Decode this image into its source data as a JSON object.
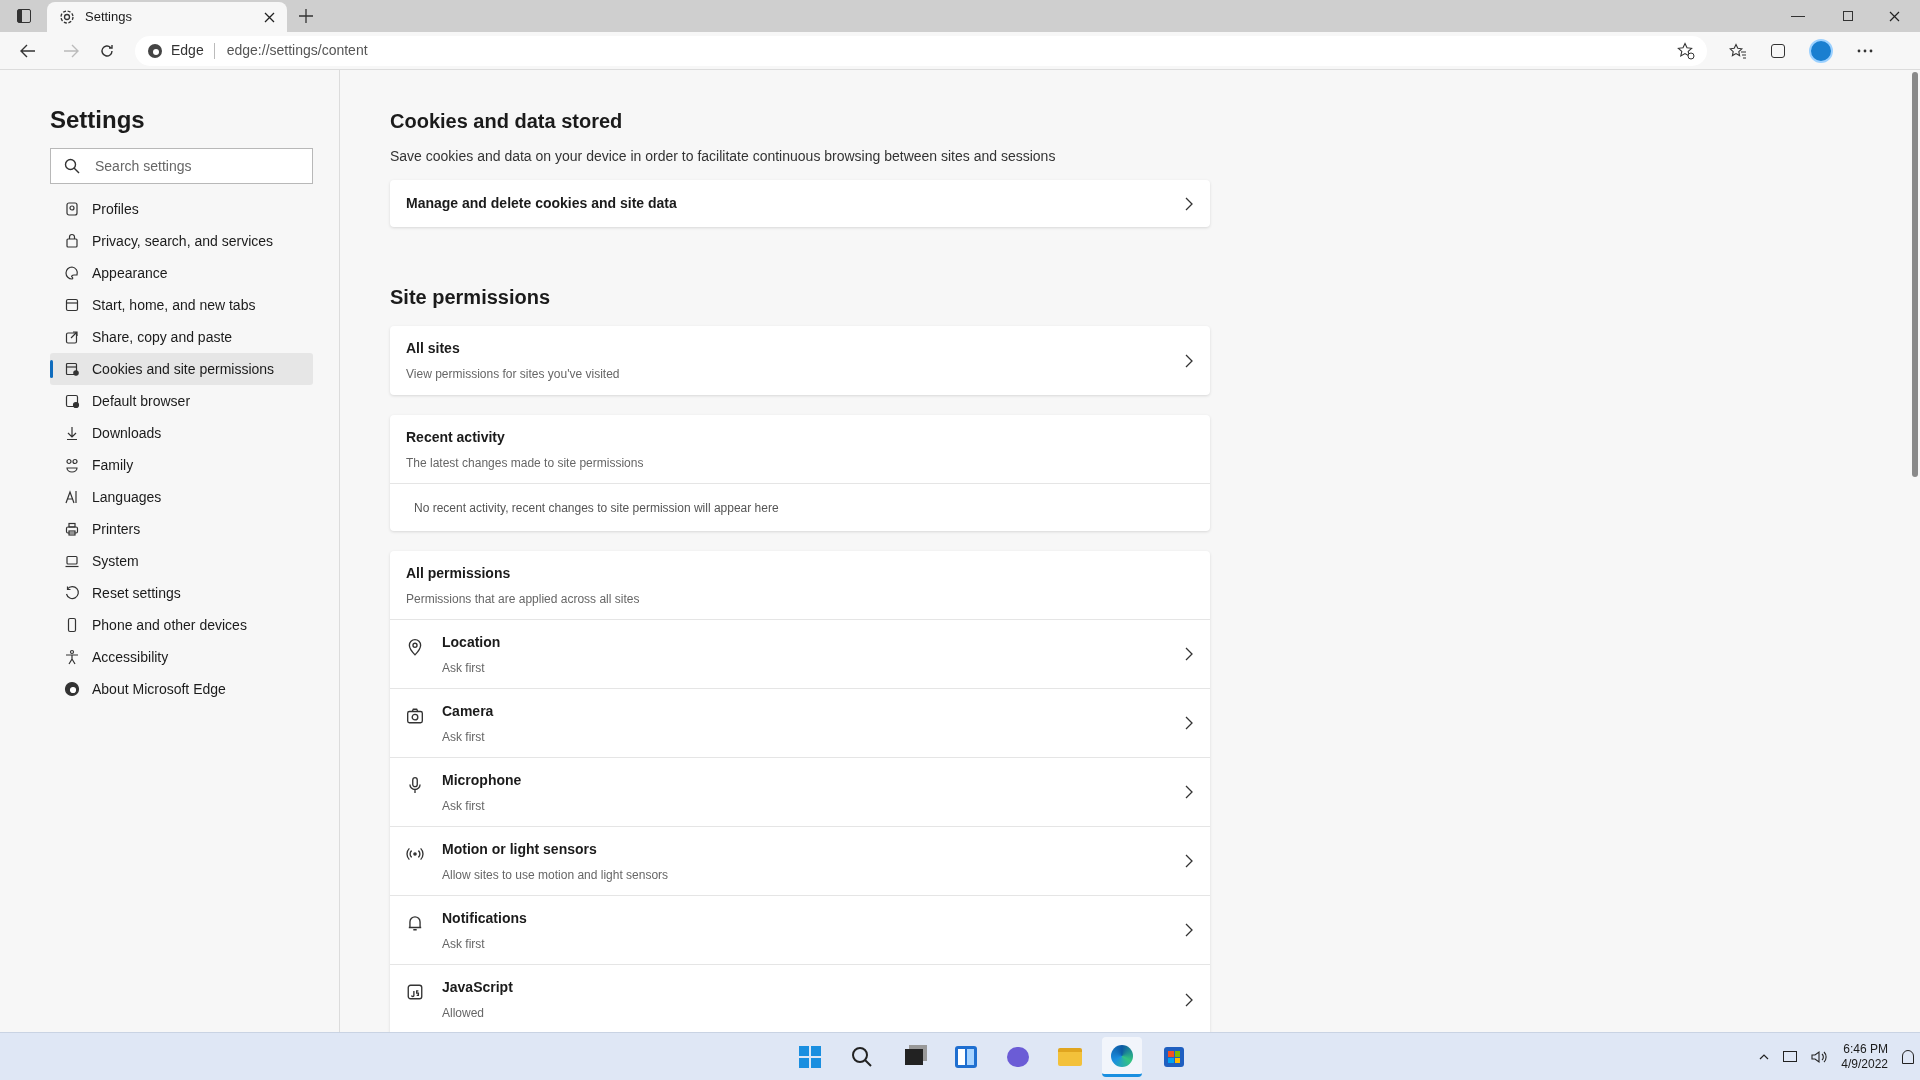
{
  "browser": {
    "tab_title": "Settings",
    "site_label": "Edge",
    "address": "edge://settings/content"
  },
  "sidebar": {
    "title": "Settings",
    "search": {
      "placeholder": "Search settings"
    },
    "items": [
      {
        "label": "Profiles",
        "selected": false
      },
      {
        "label": "Privacy, search, and services",
        "selected": false
      },
      {
        "label": "Appearance",
        "selected": false
      },
      {
        "label": "Start, home, and new tabs",
        "selected": false
      },
      {
        "label": "Share, copy and paste",
        "selected": false
      },
      {
        "label": "Cookies and site permissions",
        "selected": true
      },
      {
        "label": "Default browser",
        "selected": false
      },
      {
        "label": "Downloads",
        "selected": false
      },
      {
        "label": "Family",
        "selected": false
      },
      {
        "label": "Languages",
        "selected": false
      },
      {
        "label": "Printers",
        "selected": false
      },
      {
        "label": "System",
        "selected": false
      },
      {
        "label": "Reset settings",
        "selected": false
      },
      {
        "label": "Phone and other devices",
        "selected": false
      },
      {
        "label": "Accessibility",
        "selected": false
      },
      {
        "label": "About Microsoft Edge",
        "selected": false
      }
    ]
  },
  "cookies": {
    "heading": "Cookies and data stored",
    "description": "Save cookies and data on your device in order to facilitate continuous browsing between sites and sessions",
    "link": "Manage and delete cookies and site data"
  },
  "site_permissions": {
    "heading": "Site permissions",
    "all_sites": {
      "title": "All sites",
      "subtitle": "View permissions for sites you've visited"
    },
    "recent_activity": {
      "title": "Recent activity",
      "subtitle": "The latest changes made to site permissions",
      "empty": "No recent activity, recent changes to site permission will appear here"
    },
    "all_permissions": {
      "title": "All permissions",
      "subtitle": "Permissions that are applied across all sites",
      "items": [
        {
          "title": "Location",
          "value": "Ask first"
        },
        {
          "title": "Camera",
          "value": "Ask first"
        },
        {
          "title": "Microphone",
          "value": "Ask first"
        },
        {
          "title": "Motion or light sensors",
          "value": "Allow sites to use motion and light sensors"
        },
        {
          "title": "Notifications",
          "value": "Ask first"
        },
        {
          "title": "JavaScript",
          "value": "Allowed"
        }
      ]
    }
  },
  "taskbar": {
    "time": "6:46 PM",
    "date": "4/9/2022"
  }
}
